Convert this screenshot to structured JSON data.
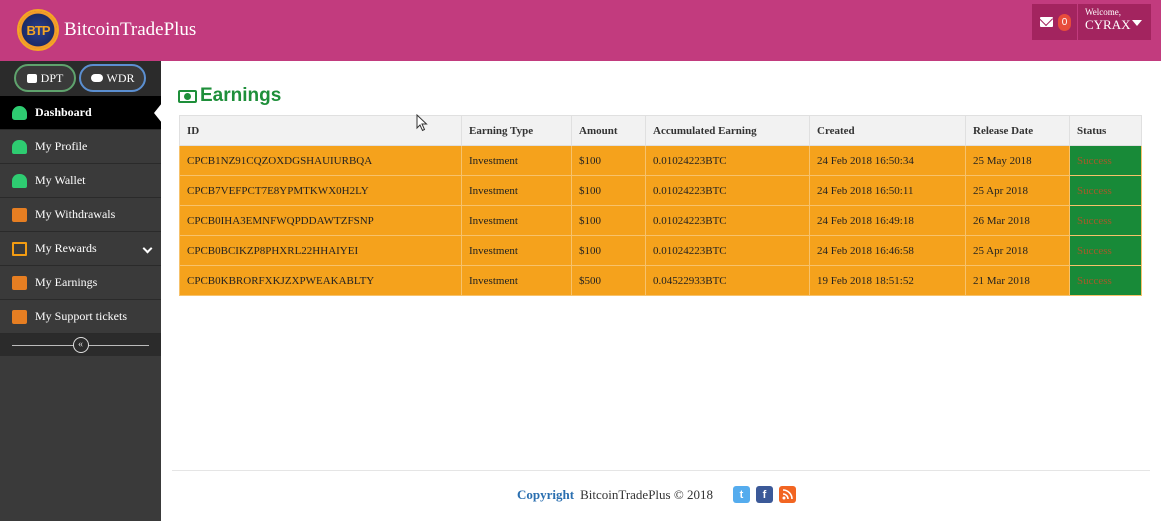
{
  "header": {
    "logo_text": "BTP",
    "brand": "BitcoinTradePlus",
    "notifications_count": "0",
    "welcome": "Welcome,",
    "username": "CYRAX"
  },
  "sidebar": {
    "deposit_label": "DPT",
    "withdraw_label": "WDR",
    "items": [
      {
        "label": "Dashboard",
        "icon": "dashboard-icon",
        "active": true
      },
      {
        "label": "My Profile",
        "icon": "user-icon"
      },
      {
        "label": "My Wallet",
        "icon": "user-icon"
      },
      {
        "label": "My Withdrawals",
        "icon": "calendar-icon"
      },
      {
        "label": "My Rewards",
        "icon": "file-icon",
        "has_submenu": true
      },
      {
        "label": "My Earnings",
        "icon": "calendar-icon"
      },
      {
        "label": "My Support tickets",
        "icon": "calendar-icon"
      }
    ],
    "collapse_glyph": "«"
  },
  "main": {
    "title": "Earnings",
    "table": {
      "columns": [
        "ID",
        "Earning Type",
        "Amount",
        "Accumulated Earning",
        "Created",
        "Release Date",
        "Status"
      ],
      "rows": [
        [
          "CPCB1NZ91CQZOXDGSHAUIURBQA",
          "Investment",
          "$100",
          "0.01024223BTC",
          "24 Feb 2018 16:50:34",
          "25 May 2018",
          "Success"
        ],
        [
          "CPCB7VEFPCT7E8YPMTKWX0H2LY",
          "Investment",
          "$100",
          "0.01024223BTC",
          "24 Feb 2018 16:50:11",
          "25 Apr 2018",
          "Success"
        ],
        [
          "CPCB0IHA3EMNFWQPDDAWTZFSNP",
          "Investment",
          "$100",
          "0.01024223BTC",
          "24 Feb 2018 16:49:18",
          "26 Mar 2018",
          "Success"
        ],
        [
          "CPCB0BCIKZP8PHXRL22HHAIYEI",
          "Investment",
          "$100",
          "0.01024223BTC",
          "24 Feb 2018 16:46:58",
          "25 Apr 2018",
          "Success"
        ],
        [
          "CPCB0KBRORFXKJZXPWEAKABLTY",
          "Investment",
          "$500",
          "0.04522933BTC",
          "19 Feb 2018 18:51:52",
          "21 Mar 2018",
          "Success"
        ]
      ]
    }
  },
  "footer": {
    "copyright_label": "Copyright",
    "text": "BitcoinTradePlus © 2018",
    "social": [
      "twitter-icon",
      "facebook-icon",
      "rss-icon"
    ]
  },
  "colors": {
    "header": "#c23b7e",
    "sidebar": "#3a3a3a",
    "row": "#f5a21c",
    "status": "#188a38",
    "title": "#1e8f3a"
  }
}
